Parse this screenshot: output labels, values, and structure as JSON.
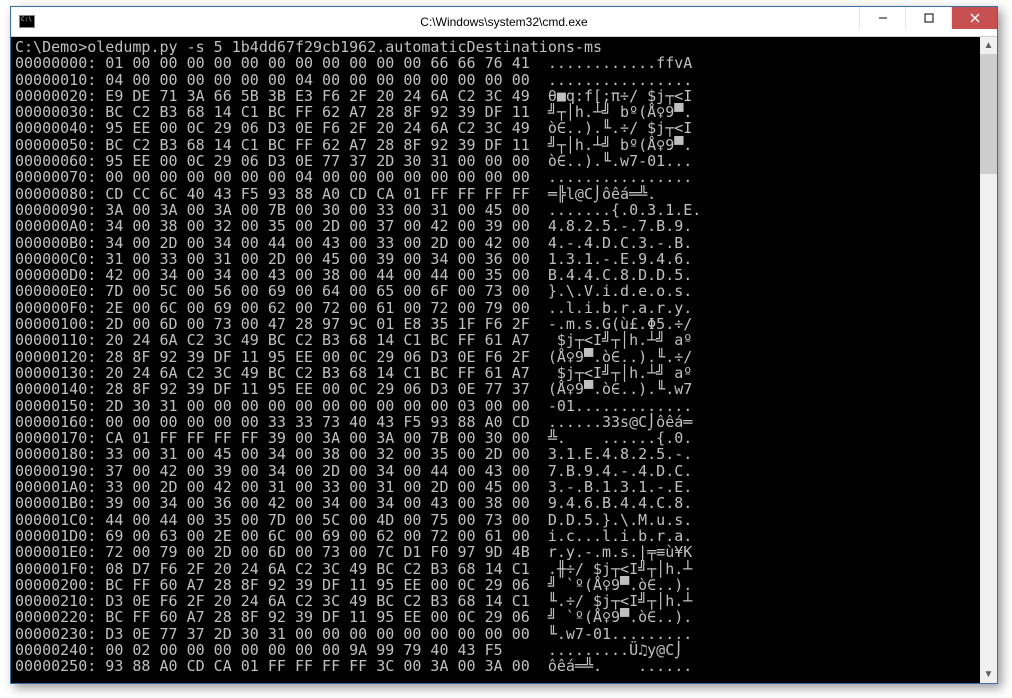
{
  "window": {
    "title": "C:\\Windows\\system32\\cmd.exe"
  },
  "prompt": "C:\\Demo>oledump.py -s 5 1b4dd67f29cb1962.automaticDestinations-ms",
  "hex_lines": [
    "00000000: 01 00 00 00 00 00 00 00 00 00 00 00 66 66 76 41  ............ffvA",
    "00000010: 04 00 00 00 00 00 00 04 00 00 00 00 00 00 00 00  ................",
    "00000020: E9 DE 71 3A 66 5B 3B E3 F6 2F 20 24 6A C2 3C 49  θ■q:f[;π÷/ $j┬<I",
    "00000030: BC C2 B3 68 14 C1 BC FF 62 A7 28 8F 92 39 DF 11  ╝┬│h.┴╝ bº(Å♀9▀.",
    "00000040: 95 EE 00 0C 29 06 D3 0E F6 2F 20 24 6A C2 3C 49  ò∈..).╙.÷/ $j┬<I",
    "00000050: BC C2 B3 68 14 C1 BC FF 62 A7 28 8F 92 39 DF 11  ╝┬│h.┴╝ bº(Å♀9▀.",
    "00000060: 95 EE 00 0C 29 06 D3 0E 77 37 2D 30 31 00 00 00  ò∈..).╙.w7-01...",
    "00000070: 00 00 00 00 00 00 00 04 00 00 00 00 00 00 00 00  ................",
    "00000080: CD CC 6C 40 43 F5 93 88 A0 CD CA 01 FF FF FF FF  ═╠l@C⌡ôêá═╩.    ",
    "00000090: 3A 00 3A 00 3A 00 7B 00 30 00 33 00 31 00 45 00  .......{.0.3.1.E.",
    "000000A0: 34 00 38 00 32 00 35 00 2D 00 37 00 42 00 39 00  4.8.2.5.-.7.B.9.",
    "000000B0: 34 00 2D 00 34 00 44 00 43 00 33 00 2D 00 42 00  4.-.4.D.C.3.-.B.",
    "000000C0: 31 00 33 00 31 00 2D 00 45 00 39 00 34 00 36 00  1.3.1.-.E.9.4.6.",
    "000000D0: 42 00 34 00 34 00 43 00 38 00 44 00 44 00 35 00  B.4.4.C.8.D.D.5.",
    "000000E0: 7D 00 5C 00 56 00 69 00 64 00 65 00 6F 00 73 00  }.\\.V.i.d.e.o.s.",
    "000000F0: 2E 00 6C 00 69 00 62 00 72 00 61 00 72 00 79 00  ..l.i.b.r.a.r.y.",
    "00000100: 2D 00 6D 00 73 00 47 28 97 9C 01 E8 35 1F F6 2F  -.m.s.G(ù£.Φ5.÷/",
    "00000110: 20 24 6A C2 3C 49 BC C2 B3 68 14 C1 BC FF 61 A7   $j┬<I╝┬│h.┴╝ aº",
    "00000120: 28 8F 92 39 DF 11 95 EE 00 0C 29 06 D3 0E F6 2F  (Å♀9▀.ò∈..).╙.÷/",
    "00000130: 20 24 6A C2 3C 49 BC C2 B3 68 14 C1 BC FF 61 A7   $j┬<I╝┬│h.┴╝ aº",
    "00000140: 28 8F 92 39 DF 11 95 EE 00 0C 29 06 D3 0E 77 37  (Å♀9▀.ò∈..).╙.w7",
    "00000150: 2D 30 31 00 00 00 00 00 00 00 00 00 00 03 00 00  -01.............",
    "00000160: 00 00 00 00 00 00 33 33 73 40 43 F5 93 88 A0 CD  ......33s@C⌡ôêá═",
    "00000170: CA 01 FF FF FF FF 39 00 3A 00 3A 00 7B 00 30 00  ╩.    ......{.0.",
    "00000180: 33 00 31 00 45 00 34 00 38 00 32 00 35 00 2D 00  3.1.E.4.8.2.5.-.",
    "00000190: 37 00 42 00 39 00 34 00 2D 00 34 00 44 00 43 00  7.B.9.4.-.4.D.C.",
    "000001A0: 33 00 2D 00 42 00 31 00 33 00 31 00 2D 00 45 00  3.-.B.1.3.1.-.E.",
    "000001B0: 39 00 34 00 36 00 42 00 34 00 34 00 43 00 38 00  9.4.6.B.4.4.C.8.",
    "000001C0: 44 00 44 00 35 00 7D 00 5C 00 4D 00 75 00 73 00  D.D.5.}.\\.M.u.s.",
    "000001D0: 69 00 63 00 2E 00 6C 00 69 00 62 00 72 00 61 00  i.c...l.i.b.r.a.",
    "000001E0: 72 00 79 00 2D 00 6D 00 73 00 7C D1 F0 97 9D 4B  r.y.-.m.s.|╤≡ù¥K",
    "000001F0: 08 D7 F6 2F 20 24 6A C2 3C 49 BC C2 B3 68 14 C1  .╫÷/ $j┬<I╝┬│h.┴",
    "00000200: BC FF 60 A7 28 8F 92 39 DF 11 95 EE 00 0C 29 06  ╝ `º(Å♀9▀.ò∈..).",
    "00000210: D3 0E F6 2F 20 24 6A C2 3C 49 BC C2 B3 68 14 C1  ╙.÷/ $j┬<I╝┬│h.┴",
    "00000220: BC FF 60 A7 28 8F 92 39 DF 11 95 EE 00 0C 29 06  ╝ `º(Å♀9▀.ò∈..).",
    "00000230: D3 0E 77 37 2D 30 31 00 00 00 00 00 00 00 00 00  ╙.w7-01.........",
    "00000240: 00 02 00 00 00 00 00 00 00 9A 99 79 40 43 F5     .........Ü♫y@C⌡",
    "00000250: 93 88 A0 CD CA 01 FF FF FF FF 3C 00 3A 00 3A 00  ôêá═╩.    ......"
  ]
}
